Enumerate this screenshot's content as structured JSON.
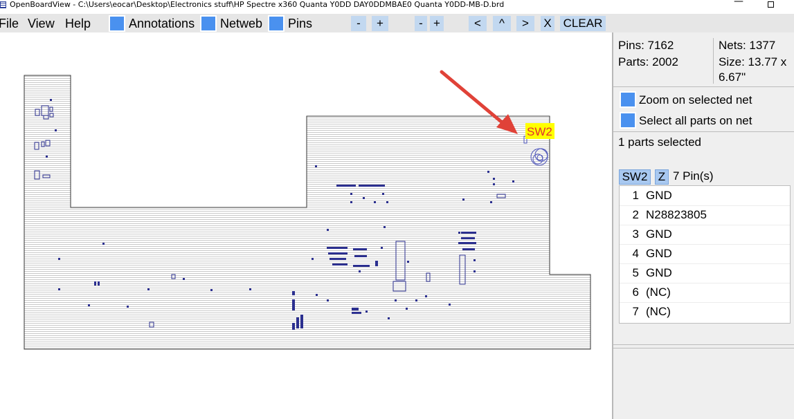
{
  "window": {
    "title": "OpenBoardView - C:\\Users\\eocar\\Desktop\\Electronics stuff\\HP Spectre x360 Quanta Y0DD DAY0DDMBAE0 Quanta Y0DD-MB-D.brd",
    "minimize_glyph": "—"
  },
  "menu": {
    "file": "File",
    "view": "View",
    "help": "Help"
  },
  "toolbar": {
    "annotations": "Annotations",
    "netweb": "Netweb",
    "pins": "Pins",
    "zoom_minus": "-",
    "zoom_plus": "+",
    "size_minus": "-",
    "size_plus": "+",
    "pan_left": "<",
    "pan_up": "^",
    "pan_right": ">",
    "close_x": "X",
    "clear": "CLEAR"
  },
  "board": {
    "callout_label": "SW2",
    "accent": "#e04238",
    "outline": "#333333",
    "parts_color": "#2b2f8f"
  },
  "stats": {
    "pins": "Pins: 7162",
    "parts": "Parts: 2002",
    "nets": "Nets: 1377",
    "size_line1": "Size: 13.77 x",
    "size_line2": "6.67\""
  },
  "options": {
    "zoom_selected_net": "Zoom on selected net",
    "select_all_parts": "Select all parts on net"
  },
  "selection": {
    "count_text": "1 parts selected",
    "part_name": "SW2",
    "z_button": "Z",
    "pin_count": "7 Pin(s)"
  },
  "pins": [
    {
      "num": "1",
      "net": "GND"
    },
    {
      "num": "2",
      "net": "N28823805"
    },
    {
      "num": "3",
      "net": "GND"
    },
    {
      "num": "4",
      "net": "GND"
    },
    {
      "num": "5",
      "net": "GND"
    },
    {
      "num": "6",
      "net": "(NC)"
    },
    {
      "num": "7",
      "net": "(NC)"
    }
  ]
}
